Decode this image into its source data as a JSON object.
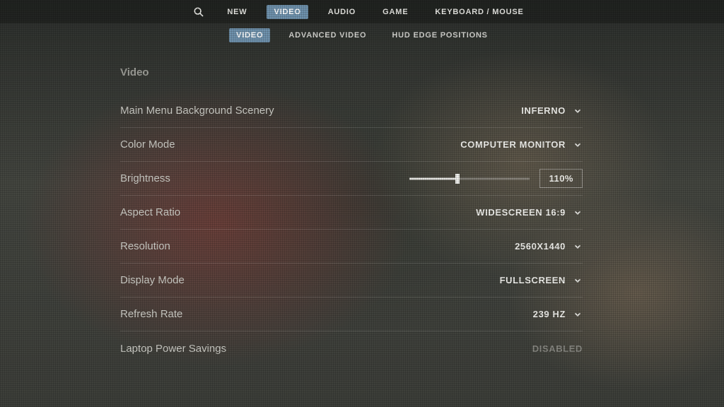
{
  "topnav": {
    "items": [
      {
        "label": "NEW",
        "active": false
      },
      {
        "label": "VIDEO",
        "active": true
      },
      {
        "label": "AUDIO",
        "active": false
      },
      {
        "label": "GAME",
        "active": false
      },
      {
        "label": "KEYBOARD / MOUSE",
        "active": false
      }
    ]
  },
  "subnav": {
    "items": [
      {
        "label": "VIDEO",
        "active": true
      },
      {
        "label": "ADVANCED VIDEO",
        "active": false
      },
      {
        "label": "HUD EDGE POSITIONS",
        "active": false
      }
    ]
  },
  "section_title": "Video",
  "settings": [
    {
      "label": "Main Menu Background Scenery",
      "value": "INFERNO",
      "type": "dropdown"
    },
    {
      "label": "Color Mode",
      "value": "COMPUTER MONITOR",
      "type": "dropdown"
    },
    {
      "label": "Brightness",
      "value": "110%",
      "type": "slider",
      "slider_pct": 40
    },
    {
      "label": "Aspect Ratio",
      "value": "WIDESCREEN 16:9",
      "type": "dropdown"
    },
    {
      "label": "Resolution",
      "value": "2560X1440",
      "type": "dropdown"
    },
    {
      "label": "Display Mode",
      "value": "FULLSCREEN",
      "type": "dropdown"
    },
    {
      "label": "Refresh Rate",
      "value": "239 HZ",
      "type": "dropdown"
    },
    {
      "label": "Laptop Power Savings",
      "value": "DISABLED",
      "type": "static"
    }
  ],
  "colors": {
    "accent": "#6f92ad"
  }
}
